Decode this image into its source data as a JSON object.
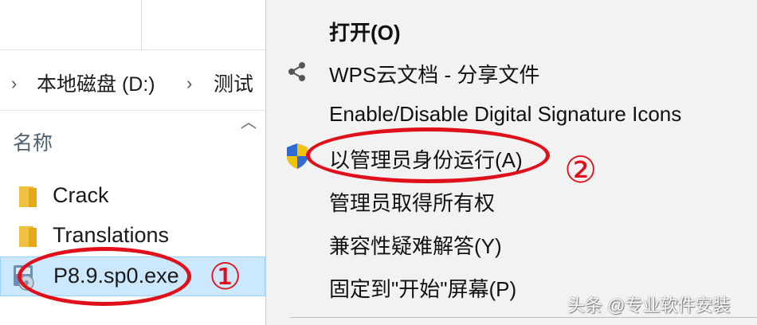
{
  "explorer": {
    "breadcrumb": [
      "本地磁盘 (D:)",
      "测试"
    ],
    "column_header": "名称",
    "files": [
      {
        "name": "Crack",
        "type": "folder"
      },
      {
        "name": "Translations",
        "type": "folder"
      },
      {
        "name": "P8.9.sp0.exe",
        "type": "exe",
        "selected": true
      }
    ]
  },
  "context_menu": {
    "items": [
      {
        "label": "打开(O)",
        "bold": true
      },
      {
        "label": "WPS云文档 - 分享文件",
        "icon": "share-icon"
      },
      {
        "label": "Enable/Disable Digital Signature Icons"
      },
      {
        "label": "以管理员身份运行(A)",
        "icon": "uac-shield-icon"
      },
      {
        "label": "管理员取得所有权"
      },
      {
        "label": "兼容性疑难解答(Y)"
      },
      {
        "label": "固定到\"开始\"屏幕(P)"
      }
    ]
  },
  "annotations": {
    "step1": "①",
    "step2": "②"
  },
  "watermark": "头条 @专业软件安装",
  "colors": {
    "annotation_red": "#e0101a",
    "selection_bg": "#cce8ff",
    "menu_bg": "#f2f2f2"
  }
}
